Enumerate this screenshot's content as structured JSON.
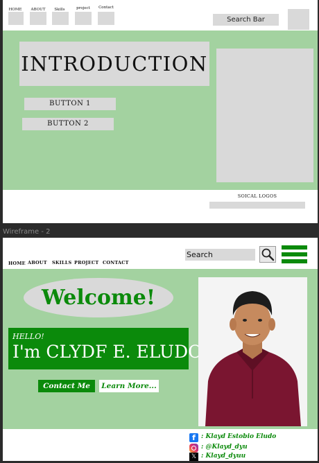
{
  "wireframe1": {
    "nav": [
      "HOME",
      "ABOUT",
      "Skills",
      "project",
      "Contact"
    ],
    "search": "Search Bar",
    "title": "INTRODUCTION",
    "button1": "BUTTON 1",
    "button2": "BUTTON 2",
    "footer_label": "SOICAL LOGOS"
  },
  "wireframe2_label": "Wireframe - 2",
  "wireframe2": {
    "search_placeholder": "Search",
    "nav": [
      "HOME",
      "ABOUT",
      "SKILLS",
      "PROJECT",
      "CONTACT"
    ],
    "welcome": "Welcome!",
    "hello": "HELLO!",
    "name": "I'm CLYDF E. ELUDO",
    "contact_button": "Contact Me",
    "learn_button": "Learn More...",
    "social": {
      "facebook": ": Klayd Estobio Eludo",
      "instagram": ": @Klayd_dyu",
      "x": ": Klayd_dyuu"
    }
  },
  "colors": {
    "hero_green": "#a3d2a0",
    "brand_green": "#0b8a0b",
    "gray_box": "#d9d9d9"
  }
}
